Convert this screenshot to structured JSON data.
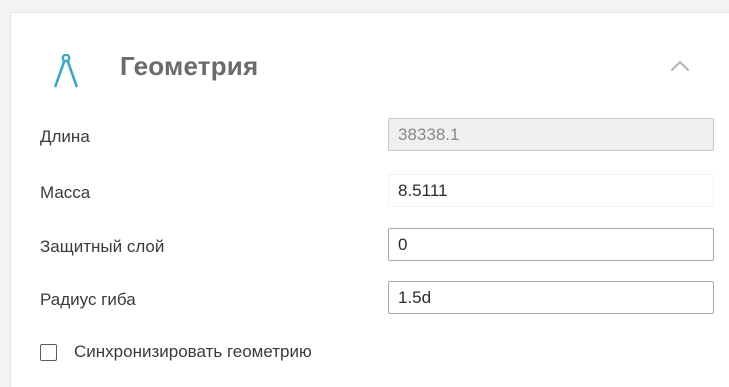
{
  "section": {
    "title": "Геометрия",
    "icon": "compass-icon",
    "collapse_icon": "chevron-up-icon",
    "accent_color": "#3aa8c4"
  },
  "fields": {
    "length": {
      "label": "Длина",
      "value": "38338.1",
      "disabled": true
    },
    "mass": {
      "label": "Масса",
      "value": "8.5111"
    },
    "cover": {
      "label": "Защитный слой",
      "value": "0"
    },
    "bend_radius": {
      "label": "Радиус гиба",
      "value": "1.5d"
    }
  },
  "sync_checkbox": {
    "label": "Синхронизировать геометрию",
    "checked": false
  }
}
